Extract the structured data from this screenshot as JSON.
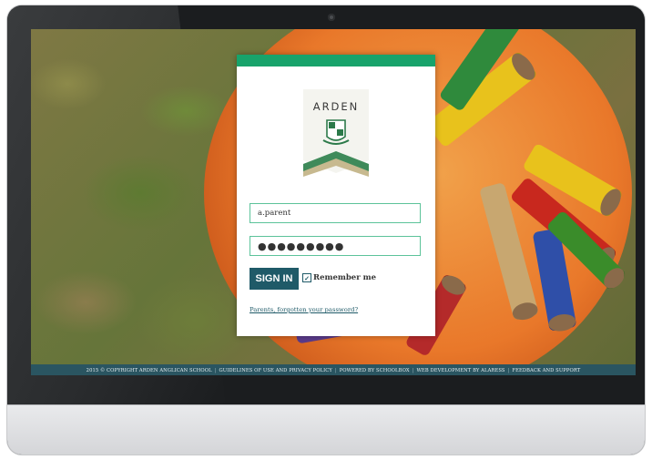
{
  "school": {
    "name": "ARDEN"
  },
  "login": {
    "username_value": "a.parent",
    "password_value": "●●●●●●●●●",
    "signin_label": "SIGN IN",
    "remember_label": "Remember me",
    "remember_checked": true,
    "forgot_label": "Parents, forgotten your password?"
  },
  "footer": {
    "items": [
      "2015 © COPYRIGHT ARDEN ANGLICAN SCHOOL",
      "GUIDELINES OF USE AND PRIVACY POLICY",
      "POWERED BY SCHOOLBOX",
      "WEB DEVELOPMENT BY ALARESS",
      "FEEDBACK AND SUPPORT"
    ],
    "separator": "|"
  },
  "colors": {
    "accent": "#18a36b",
    "primary": "#1f5a68",
    "footer_bg": "#2a5561"
  }
}
